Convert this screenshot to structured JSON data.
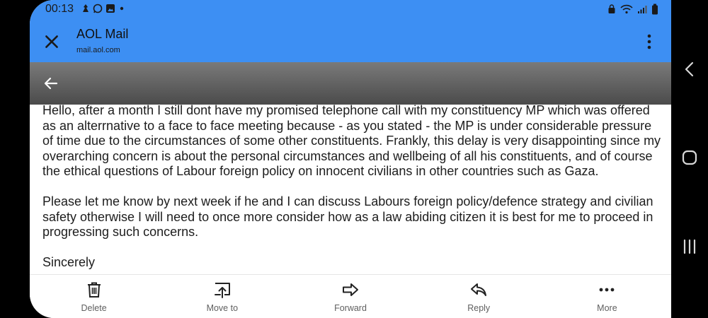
{
  "status_bar": {
    "time": "00:13"
  },
  "header": {
    "title": "AOL Mail",
    "url": "mail.aol.com"
  },
  "icons": {
    "close": "close-icon",
    "menu": "more-vertical-icon",
    "back": "arrow-back-icon"
  },
  "email": {
    "paragraphs": [
      "Hello, after a month I still dont have my promised telephone call with my constituency MP  which was offered as an alterrnative to a face to face meeting because - as you stated - the MP is under considerable pressure of time due to the circumstances of some other constituents. Frankly, this delay is very disappointing since my overarching concern is about the personal circumstances and wellbeing of all his constituents, and of course the ethical questions of Labour foreign policy on innocent civilians in other countries such as Gaza.",
      "Please let me know by next week if he and I can discuss Labours foreign policy/defence strategy and civilian safety otherwise I will need to once more consider how as a law abiding citizen it is best for me to proceed in progressing such concerns.",
      "Sincerely"
    ]
  },
  "actions": [
    {
      "label": "Delete",
      "icon": "trash-icon"
    },
    {
      "label": "Move to",
      "icon": "move-to-icon"
    },
    {
      "label": "Forward",
      "icon": "forward-icon"
    },
    {
      "label": "Reply",
      "icon": "reply-icon"
    },
    {
      "label": "More",
      "icon": "more-horizontal-icon"
    }
  ]
}
